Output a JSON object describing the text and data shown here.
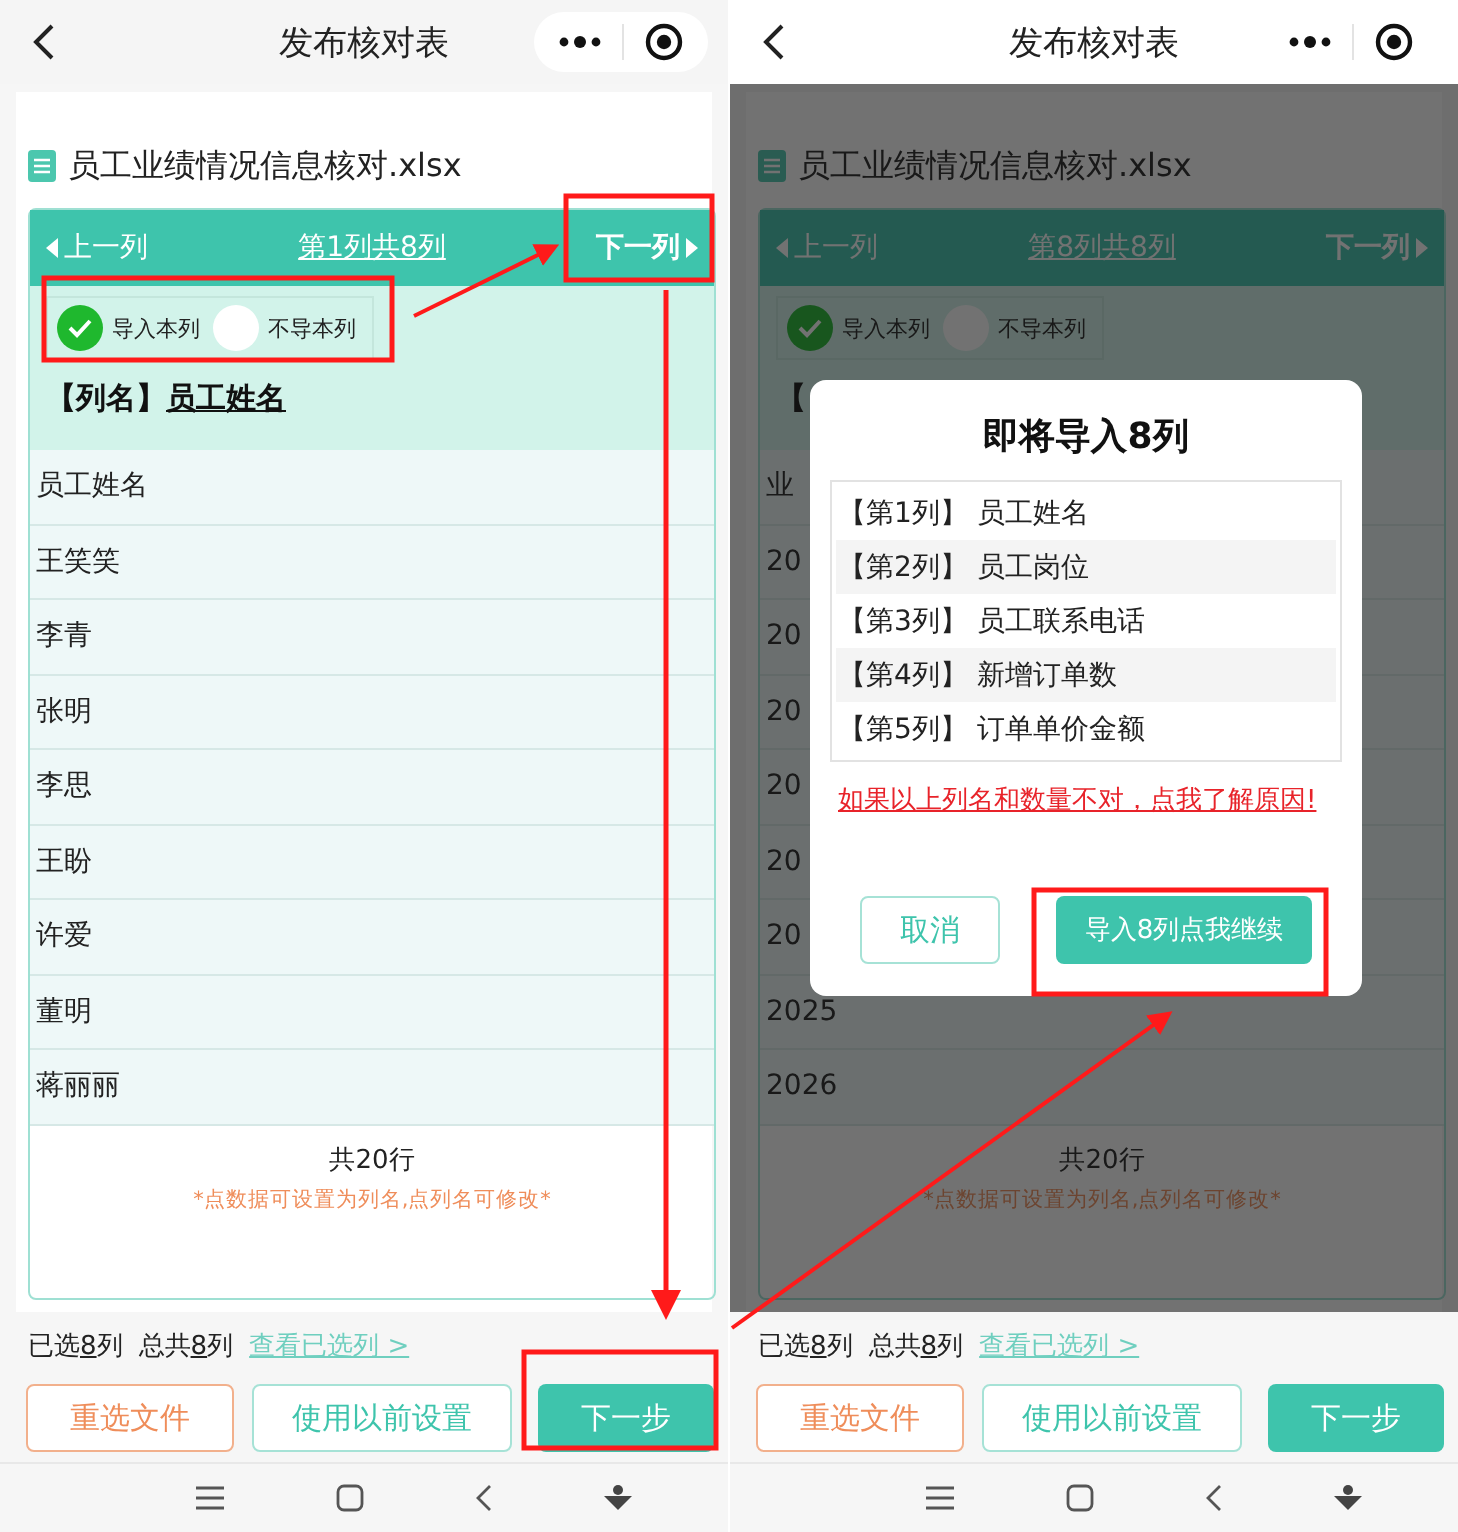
{
  "screens": [
    {
      "nav": {
        "title": "发布核对表"
      },
      "file": "员工业绩情况信息核对.xlsx",
      "pager": {
        "prev": "上一列",
        "position": "第1列共8列",
        "next": "下一列"
      },
      "toggles": [
        {
          "label": "导入本列",
          "selected": true
        },
        {
          "label": "不导本列",
          "selected": false
        }
      ],
      "column_name": {
        "label": "【列名】",
        "value": "员工姓名"
      },
      "rows": [
        "员工姓名",
        "王笑笑",
        "李青",
        "张明",
        "李思",
        "王盼",
        "许爱",
        "董明",
        "蒋丽丽"
      ],
      "total": "共20行",
      "hint": "*点数据可设置为列名,点列名可修改*",
      "summary": {
        "selected_label": "已选",
        "selected_count": "8",
        "selected_unit": "列",
        "total_label": "总共",
        "total_count": "8",
        "total_unit": "列",
        "link": "查看已选列 >"
      },
      "buttons": [
        {
          "label": "重选文件",
          "kind": "secondary"
        },
        {
          "label": "使用以前设置",
          "kind": "outline"
        },
        {
          "label": "下一步",
          "kind": "primary"
        }
      ]
    },
    {
      "nav": {
        "title": "发布核对表"
      },
      "file": "员工业绩情况信息核对.xlsx",
      "pager": {
        "prev": "上一列",
        "position": "第8列共8列",
        "next": "下一列"
      },
      "toggles": [
        {
          "label": "导入本列",
          "selected": true
        },
        {
          "label": "不导本列",
          "selected": false
        }
      ],
      "column_name": {
        "label": "【"
      },
      "rows": [
        "业",
        "20",
        "20",
        "20",
        "20",
        "20",
        "20",
        "2025",
        "2026"
      ],
      "total": "共20行",
      "hint": "*点数据可设置为列名,点列名可修改*",
      "summary": {
        "selected_label": "已选",
        "selected_count": "8",
        "selected_unit": "列",
        "total_label": "总共",
        "total_count": "8",
        "total_unit": "列",
        "link": "查看已选列 >"
      },
      "buttons": [
        {
          "label": "重选文件",
          "kind": "secondary"
        },
        {
          "label": "使用以前设置",
          "kind": "outline"
        },
        {
          "label": "下一步",
          "kind": "primary"
        }
      ],
      "dialog": {
        "title": "即将导入8列",
        "items": [
          "【第1列】 员工姓名",
          "【第2列】 员工岗位",
          "【第3列】 员工联系电话",
          "【第4列】 新增订单数",
          "【第5列】 订单单价金额"
        ],
        "link": "如果以上列名和数量不对，点我了解原因!",
        "buttons": [
          {
            "label": "取消",
            "kind": "outline"
          },
          {
            "label": "导入8列点我继续",
            "kind": "primary"
          }
        ]
      }
    }
  ]
}
